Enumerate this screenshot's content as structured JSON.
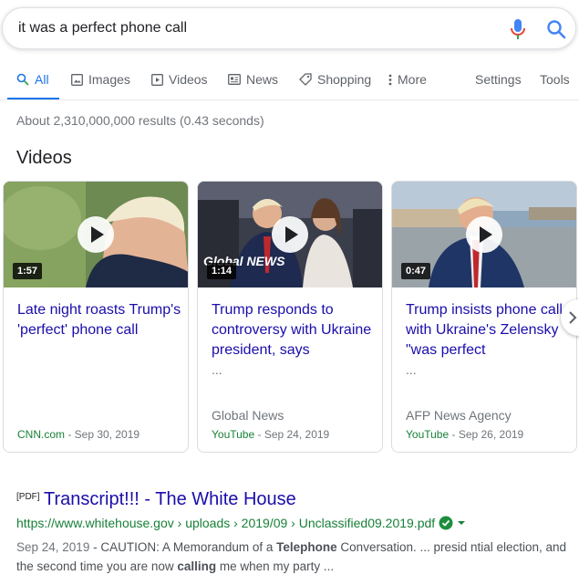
{
  "search": {
    "query": "it was a perfect phone call"
  },
  "tabs": [
    {
      "label": "All",
      "icon": "search-icon",
      "active": true
    },
    {
      "label": "Images",
      "icon": "image-icon"
    },
    {
      "label": "Videos",
      "icon": "play-icon"
    },
    {
      "label": "News",
      "icon": "news-icon"
    },
    {
      "label": "Shopping",
      "icon": "tag-icon"
    },
    {
      "label": "More",
      "icon": "more-vertical-icon"
    },
    {
      "label": "Settings"
    },
    {
      "label": "Tools"
    }
  ],
  "stats": "About 2,310,000,000 results (0.43 seconds)",
  "videos": {
    "heading": "Videos",
    "cards": [
      {
        "duration": "1:57",
        "title": "Late night roasts Trump's 'perfect' phone call",
        "ellipsis": "",
        "source": "",
        "site": "CNN.com",
        "date": " - Sep 30, 2019"
      },
      {
        "duration": "1:14",
        "title": "Trump responds to controversy with Ukraine president, says",
        "ellipsis": "...",
        "source": "Global News",
        "site": "YouTube",
        "date": " - Sep 24, 2019",
        "overlay": "Global NEWS"
      },
      {
        "duration": "0:47",
        "title": "Trump insists phone call with Ukraine's Zelensky \"was perfect",
        "ellipsis": "...",
        "source": "AFP News Agency",
        "site": "YouTube",
        "date": " - Sep 26, 2019"
      }
    ]
  },
  "result": {
    "tag": "[PDF]",
    "title": "Transcript!!! - The White House",
    "url": "https://www.whitehouse.gov › uploads › 2019/09 › Unclassified09.2019.pdf",
    "snippet": {
      "date": "Sep 24, 2019",
      "p1": " - CAUTION: A Memorandum of a ",
      "b1": "Telephone",
      "p2": " Conversation. ... presid ntial election, and the second time you are now ",
      "b2": "calling",
      "p3": " me when my party ..."
    }
  },
  "colors": {
    "link": "#1a0dab",
    "accent": "#1a73e8",
    "url_green": "#188038"
  }
}
